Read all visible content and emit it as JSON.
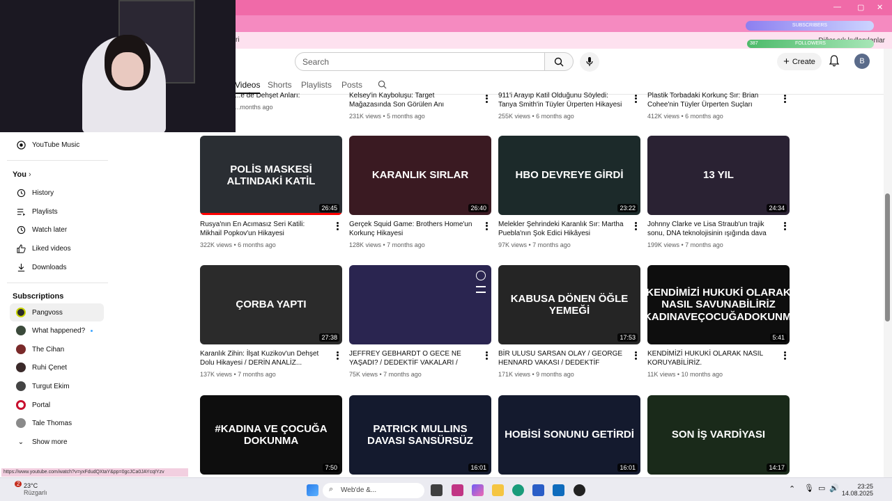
{
  "browser": {
    "bookmark_label": "ri",
    "other_bookmarks": "Diğer sık kullanılanlar",
    "status_url": "https://www.youtube.com/watch?v=yxFdudQXtaY&pp=0gcJCa0JAYcqIYzv"
  },
  "overlay": {
    "subscribers": "SUBSCRIBERS",
    "followers": "FOLLOWERS",
    "followers_count": "387"
  },
  "header": {
    "search_placeholder": "Search",
    "create_label": "Create",
    "avatar_letter": "B"
  },
  "channel_tabs": [
    "Videos",
    "Shorts",
    "Playlists",
    "Posts"
  ],
  "sidebar": {
    "music": "YouTube Music",
    "you_heading": "You",
    "you_items": [
      {
        "label": "History",
        "icon": "history-icon"
      },
      {
        "label": "Playlists",
        "icon": "playlists-icon"
      },
      {
        "label": "Watch later",
        "icon": "clock-icon"
      },
      {
        "label": "Liked videos",
        "icon": "thumbs-up-icon"
      },
      {
        "label": "Downloads",
        "icon": "download-icon"
      }
    ],
    "subs_heading": "Subscriptions",
    "subs": [
      {
        "label": "Pangvoss",
        "color": "#2a2a2a"
      },
      {
        "label": "What happened?",
        "color": "#3b4a3b"
      },
      {
        "label": "The Cihan",
        "color": "#7a2a2a"
      },
      {
        "label": "Ruhi Çenet",
        "color": "#3a2a2a"
      },
      {
        "label": "Turgut Ekim",
        "color": "#444444"
      },
      {
        "label": "Portal",
        "color": "#c8102e"
      },
      {
        "label": "Tale Thomas",
        "color": "#8a8a8a"
      }
    ],
    "show_more": "Show more"
  },
  "top_row": [
    {
      "title": "...e de Dehşet Anları: Richard",
      "meta": "...months ago"
    },
    {
      "title": "Kelsey'in Kayboluşu: Target Mağazasında Son Görülen Anı",
      "meta": "231K views • 5 months ago"
    },
    {
      "title": "911'i Arayıp Katil Olduğunu Söyledi: Tanya Smith'in Tüyler Ürperten Hikayesi",
      "meta": "255K views • 6 months ago"
    },
    {
      "title": "Plastik Torbadaki Korkunç Sır: Brian Cohee'nin Tüyler Ürperten Suçları",
      "meta": "412K views • 6 months ago"
    }
  ],
  "rows": [
    [
      {
        "thumb_text": "POLİS MASKESİ ALTINDAKİ KATİL",
        "duration": "26:45",
        "title": "Rusya'nın En Acımasız Seri Katili: Mikhail Popkov'un Hikayesi",
        "meta": "322K views • 6 months ago",
        "bg": "#2a2e33",
        "progress": 1.0
      },
      {
        "thumb_text": "KARANLIK SIRLAR",
        "duration": "26:40",
        "title": "Gerçek Squid Game: Brothers Home'un Korkunç Hikayesi",
        "meta": "128K views • 7 months ago",
        "bg": "#3a1a22",
        "progress": 0
      },
      {
        "thumb_text": "HBO DEVREYE GİRDİ",
        "duration": "23:22",
        "title": "Melekler Şehrindeki Karanlık Sır: Martha Puebla'nın Şok Edici Hikâyesi",
        "meta": "97K views • 7 months ago",
        "bg": "#1c2a2a",
        "progress": 0
      },
      {
        "thumb_text": "13 YIL",
        "duration": "24:34",
        "title": "Johnny Clarke ve Lisa Straub'un trajik sonu, DNA teknolojisinin ışığında dava yeniden...",
        "meta": "199K views • 7 months ago",
        "bg": "#2a2233",
        "progress": 0
      }
    ],
    [
      {
        "thumb_text": "ÇORBA YAPTI",
        "duration": "27:38",
        "title": "Karanlık Zihin: İlşat Kuzikov'un Dehşet Dolu Hikayesi / DERİN ANALİZ...",
        "meta": "137K views • 7 months ago",
        "bg": "#2b2b2b",
        "progress": 0
      },
      {
        "thumb_text": "",
        "duration": "",
        "title": "JEFFREY GEBHARDT O GECE NE YAŞADI? / DEDEKTİF VAKALARI /",
        "meta": "75K views • 7 months ago",
        "bg": "#2a2550",
        "progress": 0
      },
      {
        "thumb_text": "KABUSA DÖNEN ÖĞLE YEMEĞİ",
        "duration": "17:53",
        "title": "BİR ULUSU SARSAN OLAY / GEORGE HENNARD VAKASI / DEDEKTİF VAKALARI /",
        "meta": "171K views • 9 months ago",
        "bg": "#252525",
        "progress": 0
      },
      {
        "thumb_text": "KENDİMİZİ HUKUKİ OLARAK NASIL SAVUNABİLİRİZ #KADINAVEÇOCUĞADOKUNMA",
        "duration": "5:41",
        "title": "KENDİMİZİ HUKUKİ OLARAK NASIL KORUYABİLİRİZ.",
        "meta": "11K views • 10 months ago",
        "bg": "#0e0e0e",
        "progress": 0
      }
    ],
    [
      {
        "thumb_text": "#KADINA VE ÇOCUĞA DOKUNMA",
        "duration": "7:50",
        "title": "",
        "meta": "",
        "bg": "#0e0e0e",
        "progress": 0
      },
      {
        "thumb_text": "PATRICK MULLINS DAVASI SANSÜRSÜZ",
        "duration": "16:01",
        "title": "",
        "meta": "",
        "bg": "#141a2e",
        "progress": 0
      },
      {
        "thumb_text": "HOBİSİ SONUNU GETİRDİ",
        "duration": "16:01",
        "title": "",
        "meta": "",
        "bg": "#141a2e",
        "progress": 0
      },
      {
        "thumb_text": "SON İŞ VARDİYASI",
        "duration": "14:17",
        "title": "",
        "meta": "",
        "bg": "#1a2a1a",
        "progress": 0
      }
    ]
  ],
  "taskbar": {
    "temp": "23°C",
    "weather": "Rüzgarlı",
    "badge": "2",
    "search": "Web'de &...",
    "time": "23:25",
    "date": "14.08.2025"
  }
}
